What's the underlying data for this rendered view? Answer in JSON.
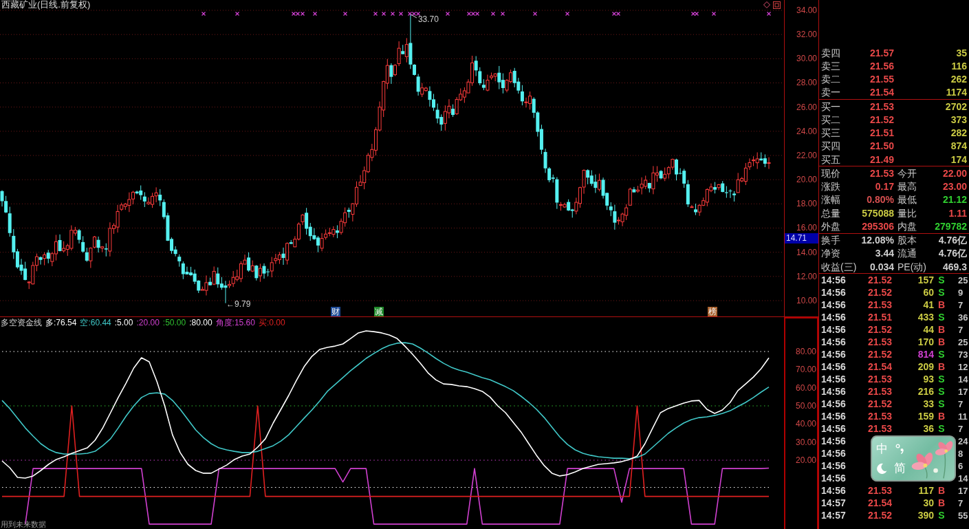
{
  "chart": {
    "title": "西藏矿业(日线.前复权)",
    "high_label": "33.70",
    "low_label": "←9.79",
    "event_tags": [
      {
        "text": "财",
        "color": "#1d4a96"
      },
      {
        "text": "减",
        "color": "#1f8a2a"
      },
      {
        "text": "榜",
        "color": "#a8602c"
      }
    ]
  },
  "price_axis": {
    "ticks": [
      "34.00",
      "32.00",
      "30.00",
      "28.00",
      "26.00",
      "24.00",
      "22.00",
      "20.00",
      "18.00",
      "16.00",
      "14.00",
      "12.00",
      "10.00"
    ],
    "cursor_label": "14.71"
  },
  "indicator": {
    "name": "多空资金线",
    "legend": [
      {
        "text": "多:76.54",
        "color": "#ffffff"
      },
      {
        "text": "空:60.44",
        "color": "#40c8c8"
      },
      {
        "text": ":5.00",
        "color": "#ffffff"
      },
      {
        "text": ":20.00",
        "color": "#d040d0"
      },
      {
        "text": ":50.00",
        "color": "#30c030"
      },
      {
        "text": ":80.00",
        "color": "#ffffff"
      },
      {
        "text": "角度:15.60",
        "color": "#d040d0"
      },
      {
        "text": "买:0.00",
        "color": "#e02020"
      }
    ],
    "chart_data": {
      "type": "line",
      "ylim": [
        -18,
        99
      ],
      "yticks": [
        {
          "value": 80,
          "label": "80.00"
        },
        {
          "value": 70,
          "label": "70.00"
        },
        {
          "value": 60,
          "label": "60.00"
        },
        {
          "value": 50,
          "label": "50.00"
        },
        {
          "value": 40,
          "label": "40.00"
        },
        {
          "value": 30,
          "label": "30.00"
        },
        {
          "value": 20,
          "label": "20.00"
        }
      ],
      "series": [
        {
          "color": "#ffffff",
          "line_style": "dotted",
          "values": [
            80,
            80,
            80,
            80,
            80,
            80,
            80,
            80,
            80,
            80,
            80,
            80,
            80,
            80,
            80,
            80,
            80,
            80,
            80,
            80,
            80,
            80,
            80,
            80,
            80,
            80,
            80,
            80,
            80,
            80,
            80,
            80,
            80,
            80,
            80,
            80,
            80,
            80,
            80,
            80,
            80,
            80,
            80,
            80,
            80,
            80,
            80,
            80,
            80,
            80,
            80,
            80,
            80,
            80,
            80,
            80,
            80,
            80,
            80,
            80,
            80,
            80,
            80,
            80,
            80,
            80,
            80,
            80,
            80,
            80,
            80,
            80,
            80,
            80,
            80,
            80,
            80,
            80,
            80,
            80,
            80,
            80,
            80,
            80,
            80,
            80,
            80,
            80,
            80,
            80,
            80,
            80,
            80,
            80,
            80,
            80,
            80,
            80,
            80,
            80
          ]
        },
        {
          "color": "#30c030",
          "line_style": "dotted",
          "values": [
            50,
            50,
            50,
            50,
            50,
            50,
            50,
            50,
            50,
            50,
            50,
            50,
            50,
            50,
            50,
            50,
            50,
            50,
            50,
            50,
            50,
            50,
            50,
            50,
            50,
            50,
            50,
            50,
            50,
            50,
            50,
            50,
            50,
            50,
            50,
            50,
            50,
            50,
            50,
            50,
            50,
            50,
            50,
            50,
            50,
            50,
            50,
            50,
            50,
            50,
            50,
            50,
            50,
            50,
            50,
            50,
            50,
            50,
            50,
            50,
            50,
            50,
            50,
            50,
            50,
            50,
            50,
            50,
            50,
            50,
            50,
            50,
            50,
            50,
            50,
            50,
            50,
            50,
            50,
            50,
            50,
            50,
            50,
            50,
            50,
            50,
            50,
            50,
            50,
            50,
            50,
            50,
            50,
            50,
            50,
            50,
            50,
            50,
            50,
            50
          ]
        },
        {
          "color": "#d040d0",
          "line_style": "dotted",
          "values": [
            20,
            20,
            20,
            20,
            20,
            20,
            20,
            20,
            20,
            20,
            20,
            20,
            20,
            20,
            20,
            20,
            20,
            20,
            20,
            20,
            20,
            20,
            20,
            20,
            20,
            20,
            20,
            20,
            20,
            20,
            20,
            20,
            20,
            20,
            20,
            20,
            20,
            20,
            20,
            20,
            20,
            20,
            20,
            20,
            20,
            20,
            20,
            20,
            20,
            20,
            20,
            20,
            20,
            20,
            20,
            20,
            20,
            20,
            20,
            20,
            20,
            20,
            20,
            20,
            20,
            20,
            20,
            20,
            20,
            20,
            20,
            20,
            20,
            20,
            20,
            20,
            20,
            20,
            20,
            20,
            20,
            20,
            20,
            20,
            20,
            20,
            20,
            20,
            20,
            20,
            20,
            20,
            20,
            20,
            20,
            20,
            20,
            20,
            20,
            20
          ]
        },
        {
          "color": "#ffffff",
          "line_style": "dotted",
          "values": [
            5,
            5,
            5,
            5,
            5,
            5,
            5,
            5,
            5,
            5,
            5,
            5,
            5,
            5,
            5,
            5,
            5,
            5,
            5,
            5,
            5,
            5,
            5,
            5,
            5,
            5,
            5,
            5,
            5,
            5,
            5,
            5,
            5,
            5,
            5,
            5,
            5,
            5,
            5,
            5,
            5,
            5,
            5,
            5,
            5,
            5,
            5,
            5,
            5,
            5,
            5,
            5,
            5,
            5,
            5,
            5,
            5,
            5,
            5,
            5,
            5,
            5,
            5,
            5,
            5,
            5,
            5,
            5,
            5,
            5,
            5,
            5,
            5,
            5,
            5,
            5,
            5,
            5,
            5,
            5,
            5,
            5,
            5,
            5,
            5,
            5,
            5,
            5,
            5,
            5,
            5,
            5,
            5,
            5,
            5,
            5,
            5,
            5,
            5,
            5
          ]
        },
        {
          "color": "#d040d0",
          "values": [
            null,
            null,
            null,
            -15.3,
            15.4,
            15.4,
            15.4,
            15.4,
            15.4,
            15.4,
            15.4,
            15.4,
            15.4,
            15.4,
            15.4,
            15.4,
            15.4,
            15.4,
            15.4,
            -15.3,
            -15.3,
            -15.3,
            -15.3,
            -15.3,
            -15.3,
            -15.3,
            -15.3,
            -15.3,
            15.4,
            15.4,
            15.4,
            15.4,
            15.4,
            15.4,
            15.4,
            15.4,
            15.4,
            15.4,
            15.4,
            15.4,
            15.4,
            15.4,
            15.4,
            15.4,
            8.0,
            15.4,
            15.4,
            15.4,
            -15.3,
            -15.3,
            -15.3,
            -15.3,
            -15.3,
            -15.3,
            -15.3,
            -15.3,
            -15.3,
            -15.3,
            -15.3,
            -15.3,
            -15.3,
            15.4,
            -15.3,
            -15.3,
            -15.3,
            -15.3,
            -15.3,
            -15.3,
            -15.3,
            -15.3,
            -15.3,
            -15.3,
            -15.3,
            15.4,
            15.4,
            15.4,
            15.4,
            15.4,
            15.4,
            15.4,
            -3.2,
            15.4,
            15.4,
            15.4,
            15.4,
            15.4,
            15.4,
            15.4,
            15.4,
            -15.3,
            -15.3,
            -15.3,
            -15.3,
            15.4,
            15.4,
            15.4,
            15.4,
            15.4,
            15.4,
            15.6
          ]
        },
        {
          "color": "#e02020",
          "values": [
            0,
            0,
            0,
            0,
            0,
            0,
            0,
            0,
            0,
            50,
            0,
            0,
            0,
            0,
            0,
            0,
            0,
            0,
            0,
            0,
            0,
            0,
            0,
            0,
            0,
            0,
            0,
            0,
            0,
            0,
            0,
            0,
            0,
            50,
            0,
            0,
            0,
            0,
            0,
            0,
            0,
            0,
            0,
            0,
            0,
            0,
            0,
            0,
            0,
            0,
            0,
            0,
            0,
            0,
            0,
            0,
            0,
            0,
            0,
            0,
            0,
            0,
            0,
            0,
            0,
            0,
            0,
            0,
            0,
            0,
            0,
            0,
            0,
            0,
            0,
            0,
            0,
            0,
            0,
            0,
            0,
            0,
            50,
            0,
            0,
            0,
            0,
            0,
            0,
            0,
            0,
            0,
            0,
            0,
            0,
            0,
            0,
            0,
            0,
            0
          ]
        },
        {
          "color": "#40c8c8",
          "values": [
            53.0,
            48.5,
            43.2,
            37.8,
            33.3,
            29.1,
            26.1,
            24.2,
            23.4,
            23.4,
            23.4,
            23.8,
            24.9,
            28.0,
            31.8,
            37.8,
            44.3,
            50.0,
            54.6,
            56.8,
            57.2,
            56.5,
            53.0,
            48.1,
            42.4,
            36.7,
            32.5,
            29.1,
            26.8,
            25.7,
            24.9,
            24.2,
            24.2,
            24.9,
            26.4,
            28.0,
            30.6,
            34.0,
            38.6,
            43.2,
            47.7,
            52.7,
            58.0,
            61.8,
            65.6,
            69.4,
            72.8,
            76.2,
            78.9,
            81.5,
            83.4,
            84.6,
            84.9,
            84.2,
            81.9,
            79.2,
            76.2,
            73.5,
            71.3,
            69.7,
            68.6,
            67.1,
            65.6,
            64.4,
            62.5,
            60.6,
            58.4,
            55.3,
            51.9,
            48.1,
            43.5,
            38.2,
            32.9,
            28.7,
            25.7,
            23.8,
            22.7,
            21.9,
            21.5,
            21.1,
            21.1,
            20.8,
            21.5,
            23.4,
            27.2,
            31.0,
            34.8,
            37.8,
            40.5,
            42.4,
            43.5,
            43.9,
            44.7,
            45.8,
            47.3,
            49.6,
            51.9,
            54.6,
            57.6,
            60.4
          ]
        },
        {
          "color": "#ffffff",
          "values": [
            19.6,
            15.8,
            10.5,
            10.1,
            11.3,
            14.3,
            17.7,
            20.4,
            21.9,
            23.8,
            25.3,
            26.8,
            31.0,
            37.8,
            46.2,
            54.6,
            62.5,
            70.9,
            76.6,
            74.3,
            63.3,
            50.0,
            34.0,
            24.2,
            17.7,
            14.3,
            12.8,
            12.8,
            15.1,
            17.3,
            20.4,
            22.3,
            23.4,
            27.2,
            31.8,
            40.5,
            48.1,
            55.7,
            64.0,
            71.6,
            77.3,
            81.1,
            82.3,
            83.0,
            84.2,
            87.2,
            90.3,
            91.4,
            91.0,
            90.3,
            89.1,
            87.2,
            83.0,
            78.5,
            73.5,
            68.2,
            64.4,
            62.1,
            61.8,
            61.0,
            60.6,
            59.5,
            58.0,
            54.9,
            50.0,
            46.2,
            40.9,
            35.6,
            29.1,
            22.7,
            17.0,
            12.8,
            11.3,
            12.0,
            13.5,
            15.4,
            16.6,
            17.7,
            18.1,
            18.5,
            19.2,
            20.4,
            22.3,
            29.1,
            37.8,
            46.2,
            48.5,
            50.0,
            51.5,
            52.7,
            53.0,
            48.1,
            45.8,
            47.7,
            51.9,
            58.4,
            62.1,
            65.9,
            70.5,
            76.5
          ]
        }
      ]
    },
    "note": "用到未来数据"
  },
  "order_book": {
    "asks": [
      {
        "label": "卖四",
        "price": "21.57",
        "volume": "35"
      },
      {
        "label": "卖三",
        "price": "21.56",
        "volume": "116"
      },
      {
        "label": "卖二",
        "price": "21.55",
        "volume": "262"
      },
      {
        "label": "卖一",
        "price": "21.54",
        "volume": "1174"
      }
    ],
    "bids": [
      {
        "label": "买一",
        "price": "21.53",
        "volume": "2702"
      },
      {
        "label": "买二",
        "price": "21.52",
        "volume": "373"
      },
      {
        "label": "买三",
        "price": "21.51",
        "volume": "282"
      },
      {
        "label": "买四",
        "price": "21.50",
        "volume": "874"
      },
      {
        "label": "买五",
        "price": "21.49",
        "volume": "174"
      }
    ]
  },
  "quote": [
    {
      "cells": [
        {
          "label": "现价",
          "value": "21.53",
          "color": "#e84848"
        },
        {
          "label": "今开",
          "value": "22.00",
          "color": "#e84848"
        }
      ]
    },
    {
      "cells": [
        {
          "label": "涨跌",
          "value": "0.17",
          "color": "#e84848"
        },
        {
          "label": "最高",
          "value": "23.00",
          "color": "#e84848"
        }
      ]
    },
    {
      "cells": [
        {
          "label": "涨幅",
          "value": "0.80%",
          "color": "#d85050"
        },
        {
          "label": "最低",
          "value": "21.12",
          "color": "#30d030"
        }
      ]
    },
    {
      "cells": [
        {
          "label": "总量",
          "value": "575088",
          "color": "#cccc44"
        },
        {
          "label": "量比",
          "value": "1.11",
          "color": "#e84848"
        }
      ]
    },
    {
      "cells": [
        {
          "label": "外盘",
          "value": "295306",
          "color": "#e84848"
        },
        {
          "label": "内盘",
          "value": "279782",
          "color": "#30d030"
        }
      ]
    }
  ],
  "capital": [
    {
      "cells": [
        {
          "label": "换手",
          "value": "12.08%"
        },
        {
          "label": "股本",
          "value": "4.76亿"
        }
      ]
    },
    {
      "cells": [
        {
          "label": "净资",
          "value": "3.44"
        },
        {
          "label": "流通",
          "value": "4.76亿"
        }
      ]
    },
    {
      "cells": [
        {
          "label": "收益(三)",
          "value": "0.034"
        },
        {
          "label": "PE(动)",
          "value": "469.3"
        }
      ]
    }
  ],
  "ticks": [
    {
      "time": "14:56",
      "price": "21.52",
      "volume": "157",
      "big_order": false,
      "side": "S",
      "buy": false,
      "column_5": "25"
    },
    {
      "time": "14:56",
      "price": "21.52",
      "volume": "60",
      "big_order": false,
      "side": "S",
      "buy": false,
      "column_5": "9"
    },
    {
      "time": "14:56",
      "price": "21.53",
      "volume": "41",
      "big_order": false,
      "side": "B",
      "buy": true,
      "column_5": "7"
    },
    {
      "time": "14:56",
      "price": "21.51",
      "volume": "433",
      "big_order": false,
      "side": "S",
      "buy": false,
      "column_5": "36"
    },
    {
      "time": "14:56",
      "price": "21.52",
      "volume": "44",
      "big_order": false,
      "side": "B",
      "buy": true,
      "column_5": "7"
    },
    {
      "time": "14:56",
      "price": "21.53",
      "volume": "170",
      "big_order": false,
      "side": "B",
      "buy": true,
      "column_5": "25"
    },
    {
      "time": "14:56",
      "price": "21.52",
      "volume": "814",
      "big_order": true,
      "side": "S",
      "buy": false,
      "column_5": "73"
    },
    {
      "time": "14:56",
      "price": "21.54",
      "volume": "209",
      "big_order": false,
      "side": "B",
      "buy": true,
      "column_5": "12"
    },
    {
      "time": "14:56",
      "price": "21.53",
      "volume": "93",
      "big_order": false,
      "side": "S",
      "buy": false,
      "column_5": "14"
    },
    {
      "time": "14:56",
      "price": "21.53",
      "volume": "216",
      "big_order": false,
      "side": "S",
      "buy": false,
      "column_5": "17"
    },
    {
      "time": "14:56",
      "price": "21.52",
      "volume": "33",
      "big_order": false,
      "side": "S",
      "buy": false,
      "column_5": "7"
    },
    {
      "time": "14:56",
      "price": "21.53",
      "volume": "159",
      "big_order": false,
      "side": "B",
      "buy": true,
      "column_5": "11"
    },
    {
      "time": "14:56",
      "price": "21.53",
      "volume": "36",
      "big_order": false,
      "side": "S",
      "buy": false,
      "column_5": "7"
    },
    {
      "time": "14:56",
      "column_5": "24"
    },
    {
      "time": "14:56",
      "column_5": "8"
    },
    {
      "time": "14:56",
      "column_5": "6"
    },
    {
      "time": "14:56",
      "column_5": "14"
    },
    {
      "time": "14:56",
      "price": "21.53",
      "volume": "117",
      "big_order": false,
      "side": "B",
      "buy": true,
      "column_5": "17"
    },
    {
      "time": "14:57",
      "price": "21.54",
      "volume": "30",
      "big_order": false,
      "side": "B",
      "buy": true,
      "column_5": "7"
    },
    {
      "time": "14:57",
      "price": "21.52",
      "volume": "390",
      "big_order": false,
      "side": "S",
      "buy": false,
      "column_5": "55"
    }
  ],
  "ime_toolbar": {
    "language": "中",
    "script": "简"
  }
}
